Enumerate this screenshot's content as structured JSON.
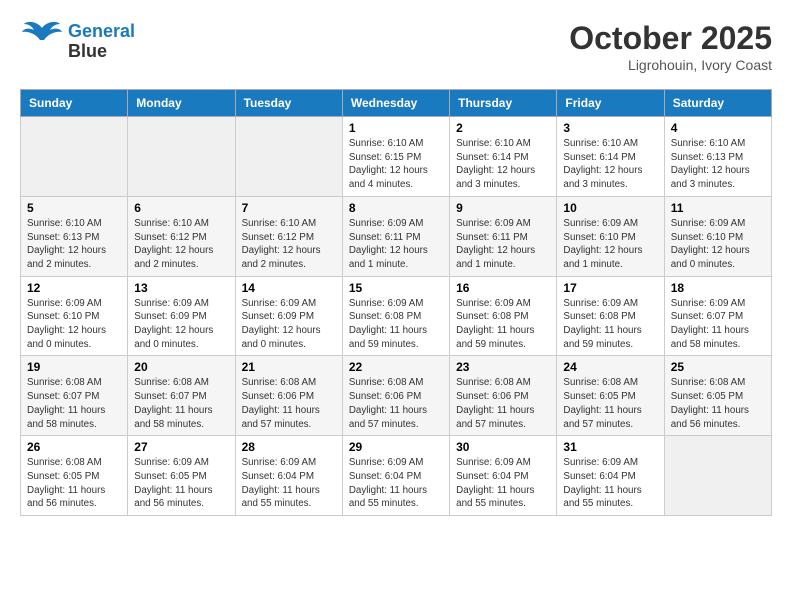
{
  "header": {
    "logo_line1": "General",
    "logo_line2": "Blue",
    "month": "October 2025",
    "location": "Ligrohouin, Ivory Coast"
  },
  "weekdays": [
    "Sunday",
    "Monday",
    "Tuesday",
    "Wednesday",
    "Thursday",
    "Friday",
    "Saturday"
  ],
  "weeks": [
    [
      {
        "day": "",
        "info": ""
      },
      {
        "day": "",
        "info": ""
      },
      {
        "day": "",
        "info": ""
      },
      {
        "day": "1",
        "info": "Sunrise: 6:10 AM\nSunset: 6:15 PM\nDaylight: 12 hours\nand 4 minutes."
      },
      {
        "day": "2",
        "info": "Sunrise: 6:10 AM\nSunset: 6:14 PM\nDaylight: 12 hours\nand 3 minutes."
      },
      {
        "day": "3",
        "info": "Sunrise: 6:10 AM\nSunset: 6:14 PM\nDaylight: 12 hours\nand 3 minutes."
      },
      {
        "day": "4",
        "info": "Sunrise: 6:10 AM\nSunset: 6:13 PM\nDaylight: 12 hours\nand 3 minutes."
      }
    ],
    [
      {
        "day": "5",
        "info": "Sunrise: 6:10 AM\nSunset: 6:13 PM\nDaylight: 12 hours\nand 2 minutes."
      },
      {
        "day": "6",
        "info": "Sunrise: 6:10 AM\nSunset: 6:12 PM\nDaylight: 12 hours\nand 2 minutes."
      },
      {
        "day": "7",
        "info": "Sunrise: 6:10 AM\nSunset: 6:12 PM\nDaylight: 12 hours\nand 2 minutes."
      },
      {
        "day": "8",
        "info": "Sunrise: 6:09 AM\nSunset: 6:11 PM\nDaylight: 12 hours\nand 1 minute."
      },
      {
        "day": "9",
        "info": "Sunrise: 6:09 AM\nSunset: 6:11 PM\nDaylight: 12 hours\nand 1 minute."
      },
      {
        "day": "10",
        "info": "Sunrise: 6:09 AM\nSunset: 6:10 PM\nDaylight: 12 hours\nand 1 minute."
      },
      {
        "day": "11",
        "info": "Sunrise: 6:09 AM\nSunset: 6:10 PM\nDaylight: 12 hours\nand 0 minutes."
      }
    ],
    [
      {
        "day": "12",
        "info": "Sunrise: 6:09 AM\nSunset: 6:10 PM\nDaylight: 12 hours\nand 0 minutes."
      },
      {
        "day": "13",
        "info": "Sunrise: 6:09 AM\nSunset: 6:09 PM\nDaylight: 12 hours\nand 0 minutes."
      },
      {
        "day": "14",
        "info": "Sunrise: 6:09 AM\nSunset: 6:09 PM\nDaylight: 12 hours\nand 0 minutes."
      },
      {
        "day": "15",
        "info": "Sunrise: 6:09 AM\nSunset: 6:08 PM\nDaylight: 11 hours\nand 59 minutes."
      },
      {
        "day": "16",
        "info": "Sunrise: 6:09 AM\nSunset: 6:08 PM\nDaylight: 11 hours\nand 59 minutes."
      },
      {
        "day": "17",
        "info": "Sunrise: 6:09 AM\nSunset: 6:08 PM\nDaylight: 11 hours\nand 59 minutes."
      },
      {
        "day": "18",
        "info": "Sunrise: 6:09 AM\nSunset: 6:07 PM\nDaylight: 11 hours\nand 58 minutes."
      }
    ],
    [
      {
        "day": "19",
        "info": "Sunrise: 6:08 AM\nSunset: 6:07 PM\nDaylight: 11 hours\nand 58 minutes."
      },
      {
        "day": "20",
        "info": "Sunrise: 6:08 AM\nSunset: 6:07 PM\nDaylight: 11 hours\nand 58 minutes."
      },
      {
        "day": "21",
        "info": "Sunrise: 6:08 AM\nSunset: 6:06 PM\nDaylight: 11 hours\nand 57 minutes."
      },
      {
        "day": "22",
        "info": "Sunrise: 6:08 AM\nSunset: 6:06 PM\nDaylight: 11 hours\nand 57 minutes."
      },
      {
        "day": "23",
        "info": "Sunrise: 6:08 AM\nSunset: 6:06 PM\nDaylight: 11 hours\nand 57 minutes."
      },
      {
        "day": "24",
        "info": "Sunrise: 6:08 AM\nSunset: 6:05 PM\nDaylight: 11 hours\nand 57 minutes."
      },
      {
        "day": "25",
        "info": "Sunrise: 6:08 AM\nSunset: 6:05 PM\nDaylight: 11 hours\nand 56 minutes."
      }
    ],
    [
      {
        "day": "26",
        "info": "Sunrise: 6:08 AM\nSunset: 6:05 PM\nDaylight: 11 hours\nand 56 minutes."
      },
      {
        "day": "27",
        "info": "Sunrise: 6:09 AM\nSunset: 6:05 PM\nDaylight: 11 hours\nand 56 minutes."
      },
      {
        "day": "28",
        "info": "Sunrise: 6:09 AM\nSunset: 6:04 PM\nDaylight: 11 hours\nand 55 minutes."
      },
      {
        "day": "29",
        "info": "Sunrise: 6:09 AM\nSunset: 6:04 PM\nDaylight: 11 hours\nand 55 minutes."
      },
      {
        "day": "30",
        "info": "Sunrise: 6:09 AM\nSunset: 6:04 PM\nDaylight: 11 hours\nand 55 minutes."
      },
      {
        "day": "31",
        "info": "Sunrise: 6:09 AM\nSunset: 6:04 PM\nDaylight: 11 hours\nand 55 minutes."
      },
      {
        "day": "",
        "info": ""
      }
    ]
  ]
}
